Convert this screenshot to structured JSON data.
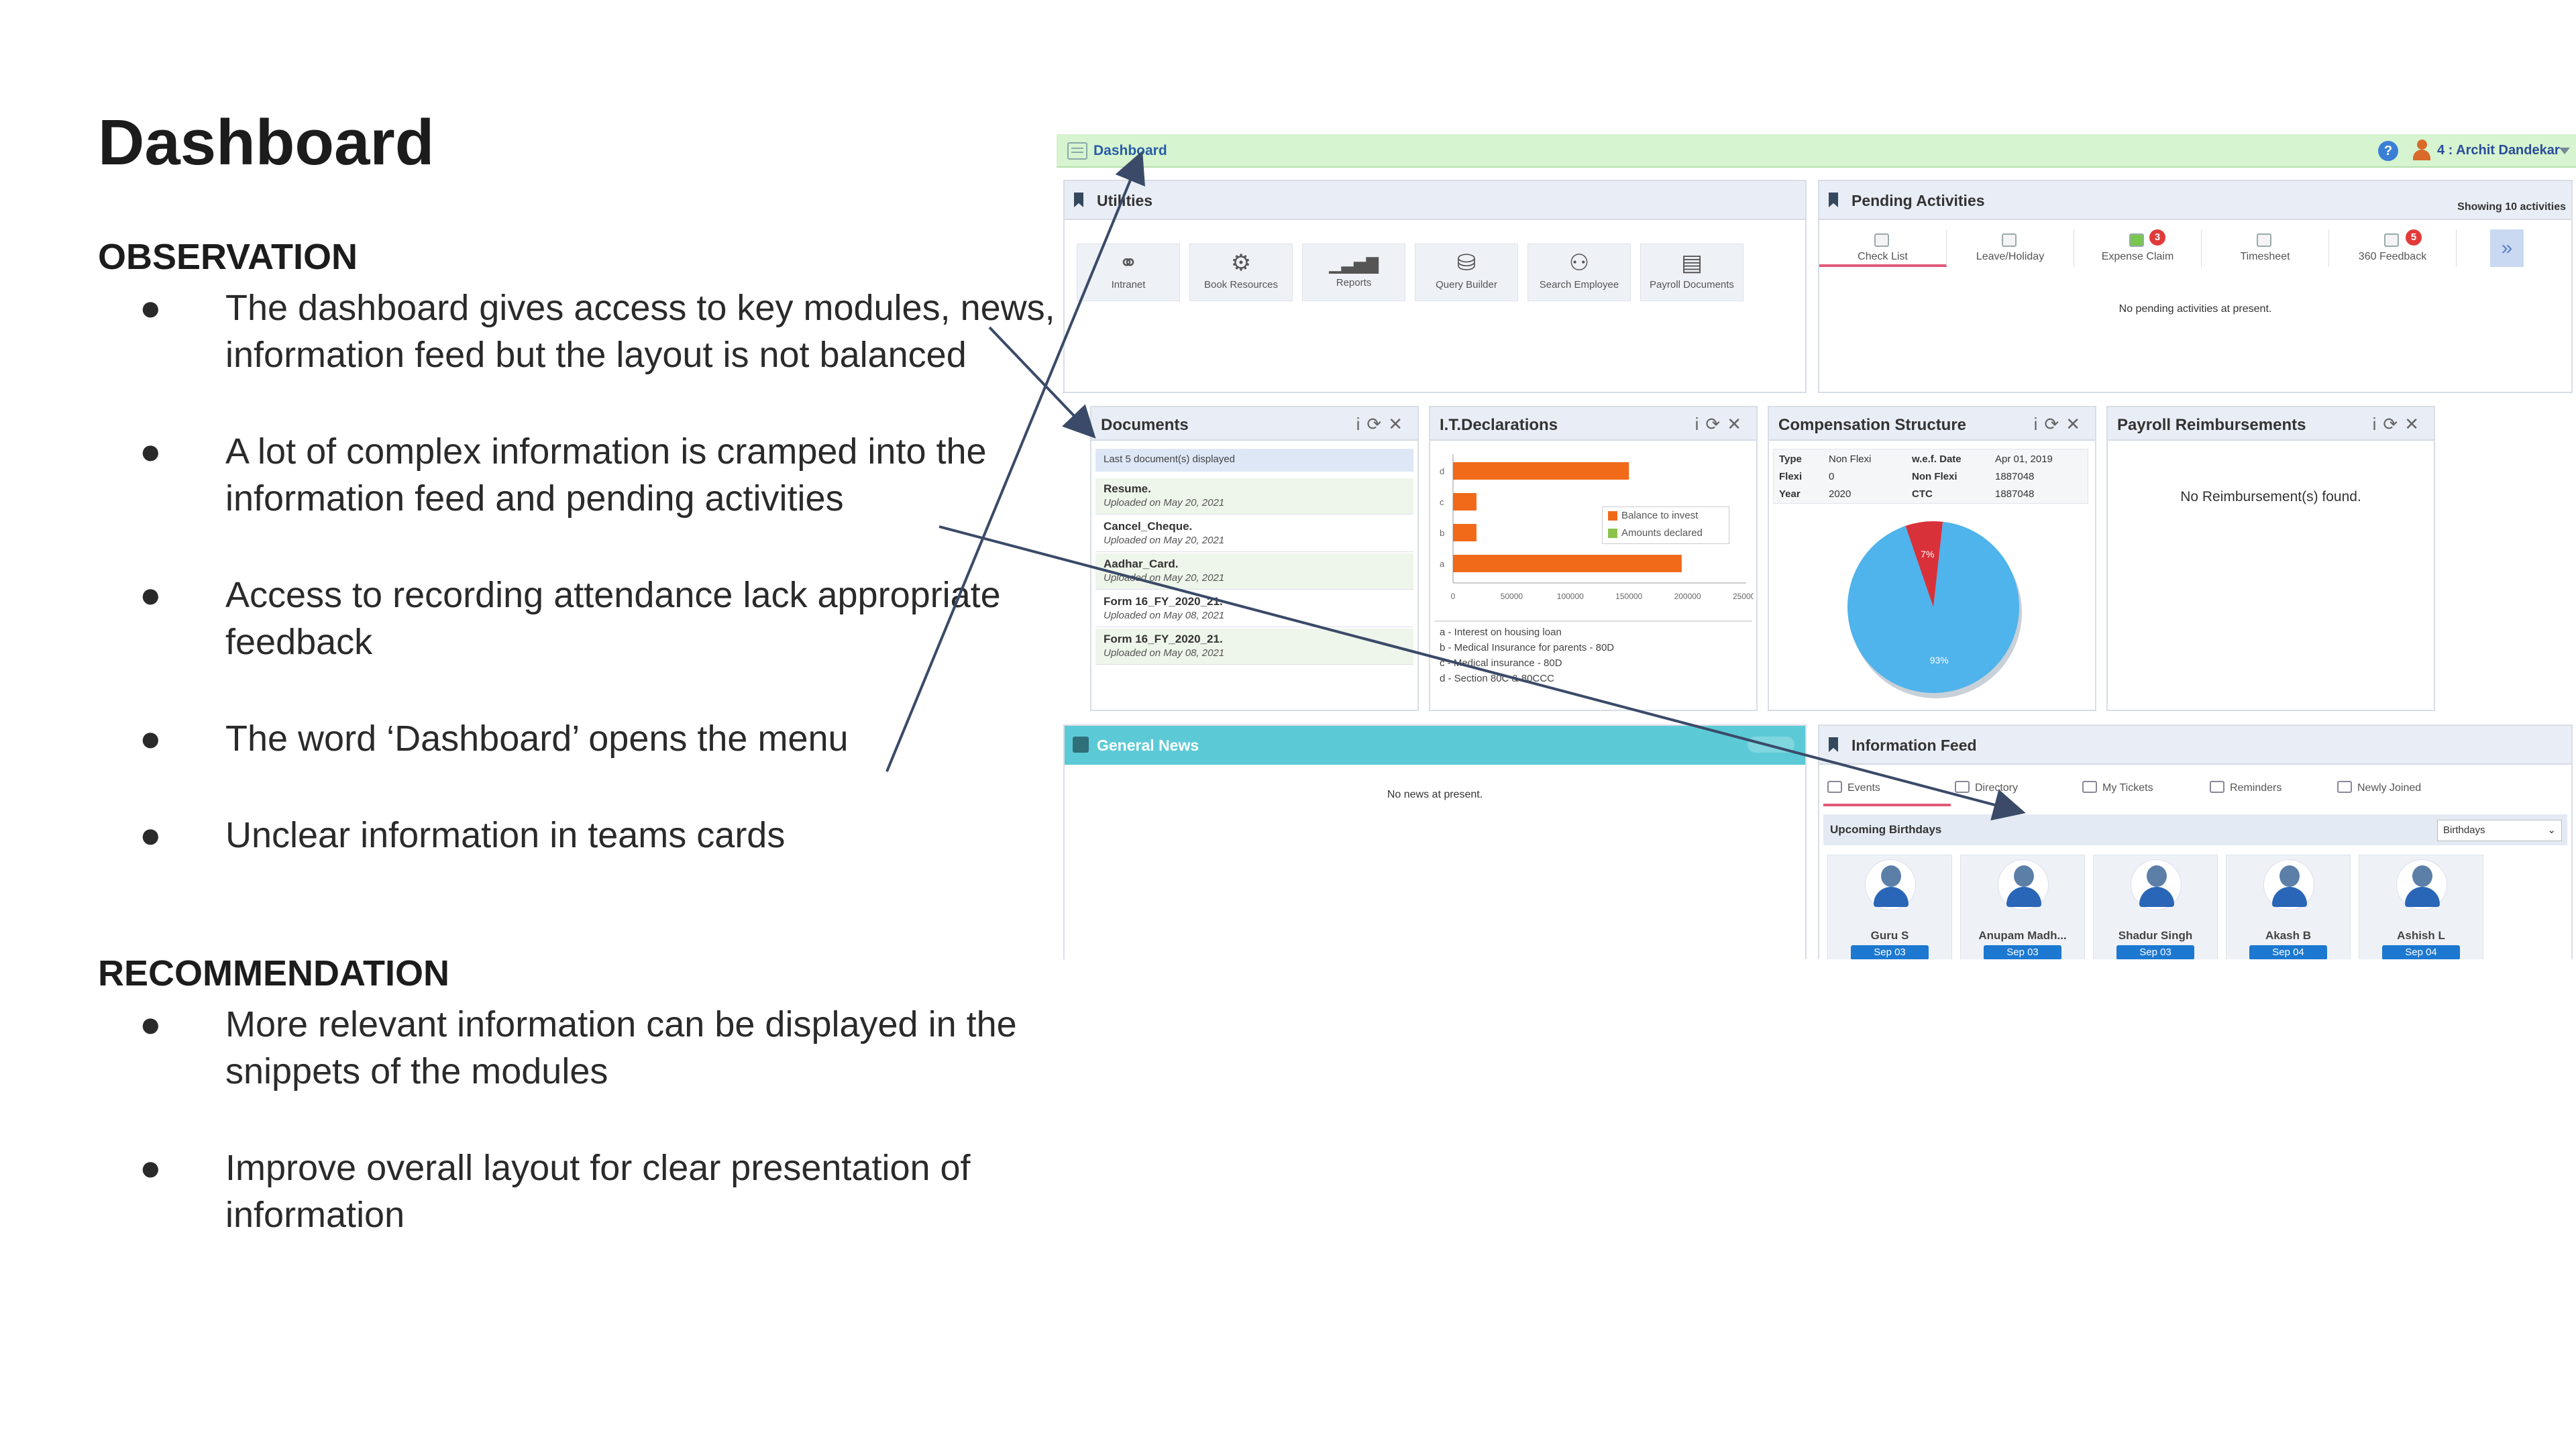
{
  "slide": {
    "title": "Dashboard",
    "observation_heading": "OBSERVATION",
    "observations": [
      "The dashboard gives access to key modules, news, information feed but the layout is not balanced",
      "A lot of complex information is cramped into the information feed and pending activities",
      "Access to recording attendance lack appropriate feedback",
      "The word ‘Dashboard’ opens the menu",
      "Unclear information in teams cards"
    ],
    "recommendation_heading": "RECOMMENDATION",
    "recommendations": [
      "More relevant information can be displayed in the snippets of the modules",
      "Improve overall layout for clear presentation of information"
    ],
    "bullet": "●"
  },
  "screenshot": {
    "topbar": {
      "menu_label": "Dashboard",
      "help_icon": "question-icon",
      "user_label": "4 : Archit Dandekar"
    },
    "utilities": {
      "title": "Utilities",
      "items": [
        {
          "label": "Intranet",
          "icon": "⚭"
        },
        {
          "label": "Book Resources",
          "icon": "⚙"
        },
        {
          "label": "Reports",
          "icon": "▁▃▅▇"
        },
        {
          "label": "Query Builder",
          "icon": "⛁"
        },
        {
          "label": "Search Employee",
          "icon": "⚇"
        },
        {
          "label": "Payroll Documents",
          "icon": "▤"
        }
      ]
    },
    "pending": {
      "title": "Pending Activities",
      "showing": "Showing 10 activities",
      "tabs": [
        "Check List",
        "Leave/Holiday",
        "Expense Claim",
        "Timesheet",
        "360 Feedback"
      ],
      "expense_badge": "3",
      "feedback_badge": "5",
      "empty": "No pending activities at present."
    },
    "documents": {
      "title": "Documents",
      "note": "Last 5 document(s) displayed",
      "rows": [
        {
          "name": "Resume.",
          "date": "Uploaded on May 20, 2021"
        },
        {
          "name": "Cancel_Cheque.",
          "date": "Uploaded on May 20, 2021"
        },
        {
          "name": "Aadhar_Card.",
          "date": "Uploaded on May 20, 2021"
        },
        {
          "name": "Form 16_FY_2020_21.",
          "date": "Uploaded on May 08, 2021"
        },
        {
          "name": "Form 16_FY_2020_21.",
          "date": "Uploaded on May 08, 2021"
        }
      ]
    },
    "it_declarations": {
      "title": "I.T.Declarations",
      "legend": [
        "Balance to invest",
        "Amounts declared"
      ],
      "notes": [
        "a - Interest on housing loan",
        "b - Medical Insurance for parents - 80D",
        "c - Medical insurance - 80D",
        "d - Section 80C & 80CCC"
      ]
    },
    "compensation": {
      "title": "Compensation Structure",
      "rows": [
        [
          "Type",
          "Non Flexi",
          "w.e.f. Date",
          "Apr 01, 2019"
        ],
        [
          "Flexi",
          "0",
          "Non Flexi",
          "1887048"
        ],
        [
          "Year",
          "2020",
          "CTC",
          "1887048"
        ]
      ],
      "pie_labels": [
        "93%",
        "7%"
      ]
    },
    "payroll": {
      "title": "Payroll Reimbursements",
      "empty": "No Reimbursement(s) found."
    },
    "news": {
      "title": "General News",
      "empty": "No news at present."
    },
    "info_feed": {
      "title": "Information Feed",
      "tabs": [
        "Events",
        "Directory",
        "My Tickets",
        "Reminders",
        "Newly Joined"
      ],
      "sub_title": "Upcoming Birthdays",
      "select_value": "Birthdays",
      "people": [
        {
          "name": "Guru S",
          "date": "Sep 03"
        },
        {
          "name": "Anupam Madh...",
          "date": "Sep 03"
        },
        {
          "name": "Shadur Singh",
          "date": "Sep 03"
        },
        {
          "name": "Akash B",
          "date": "Sep 04"
        },
        {
          "name": "Ashish L",
          "date": "Sep 04"
        }
      ]
    },
    "colors": {
      "bar_orange": "#f06a1a",
      "legend_green": "#8bc34a",
      "pie_blue": "#4fb3ec",
      "pie_red": "#d9313a",
      "news_teal": "#5ccad6",
      "topbar_green": "#d6f4cf"
    },
    "it_chart": {
      "type": "bar",
      "categories": [
        "d",
        "c",
        "b",
        "a"
      ],
      "values": [
        150000,
        20000,
        20000,
        195000
      ],
      "xlim": [
        0,
        250000
      ],
      "xticks": [
        "0",
        "50000",
        "100000",
        "150000",
        "200000",
        "250000"
      ]
    },
    "pie_chart": {
      "type": "pie",
      "values": [
        93,
        7
      ]
    }
  }
}
